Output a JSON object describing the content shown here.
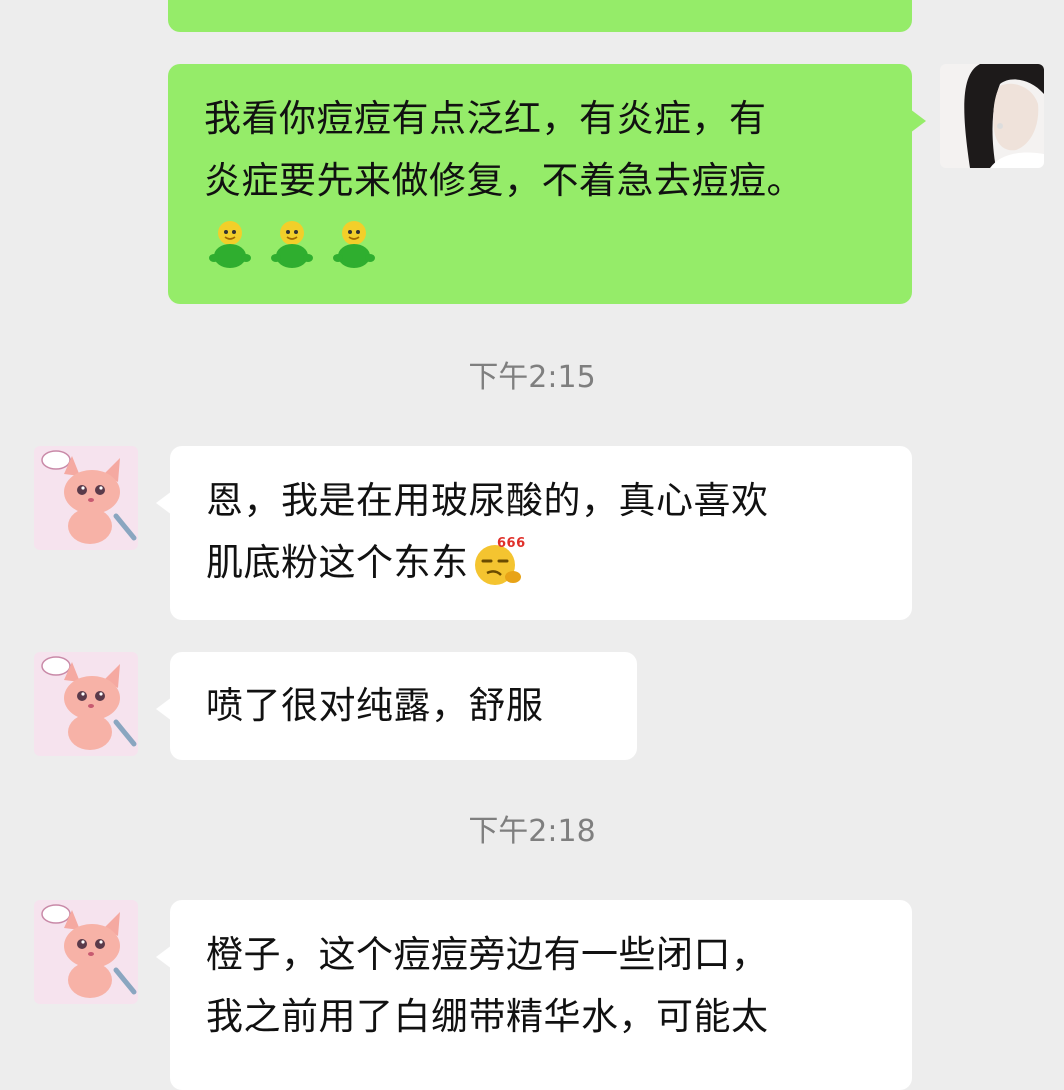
{
  "messages": [
    {
      "side": "right",
      "partial": true,
      "lines": []
    },
    {
      "side": "right",
      "lines": [
        "我看你痘痘有点泛红，有炎症，有",
        "炎症要先来做修复，不着急去痘痘。"
      ],
      "emojis": [
        "green-figure-emoji",
        "green-figure-emoji",
        "green-figure-emoji"
      ]
    },
    {
      "timestamp": "下午2:15"
    },
    {
      "side": "left",
      "lines": [
        "恩，我是在用玻尿酸的，真心喜欢",
        "肌底粉这个东东"
      ],
      "trailing_emoji": "666-smirk-emoji",
      "trailing_emoji_text": "666"
    },
    {
      "side": "left",
      "lines": [
        "喷了很对纯露，舒服"
      ]
    },
    {
      "timestamp": "下午2:18"
    },
    {
      "side": "left",
      "lines": [
        "橙子，这个痘痘旁边有一些闭口，",
        "我之前用了白绷带精华水，可能太"
      ]
    }
  ],
  "colors": {
    "background": "#ededed",
    "self_bubble": "#95ec69",
    "other_bubble": "#ffffff",
    "timestamp_text": "#7f7f7f"
  },
  "icons": {
    "self_avatar": "woman-photo-avatar",
    "other_avatar": "pink-fox-cartoon-avatar"
  }
}
